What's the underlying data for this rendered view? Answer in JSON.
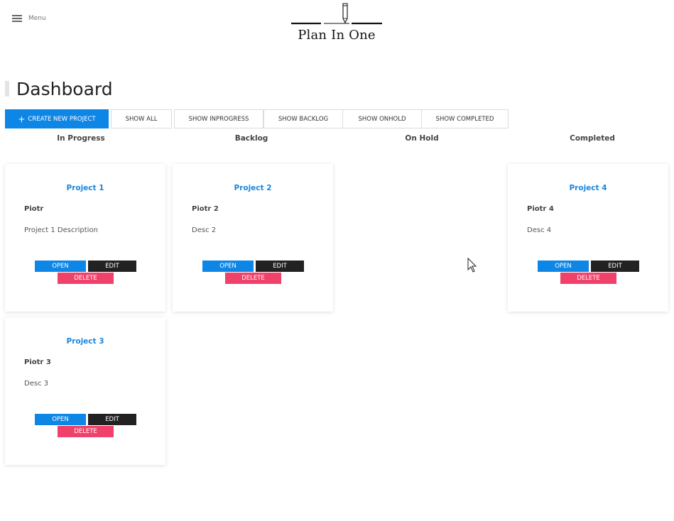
{
  "header": {
    "menu_label": "Menu",
    "logo_text": "Plan In One"
  },
  "page_title": "Dashboard",
  "filters": {
    "create": "CREATE NEW PROJECT",
    "show_all": "SHOW ALL",
    "show_inprogress": "SHOW INPROGRESS",
    "show_backlog": "SHOW BACKLOG",
    "show_onhold": "SHOW ONHOLD",
    "show_completed": "SHOW COMPLETED"
  },
  "columns": [
    "In Progress",
    "Backlog",
    "On Hold",
    "Completed"
  ],
  "card_buttons": {
    "open": "OPEN",
    "edit": "EDIT",
    "delete": "DELETE"
  },
  "projects": [
    {
      "title": "Project 1",
      "owner": "Piotr",
      "desc": "Project 1 Description",
      "status": "In Progress"
    },
    {
      "title": "Project 2",
      "owner": "Piotr 2",
      "desc": "Desc 2",
      "status": "Backlog"
    },
    {
      "title": "Project 4",
      "owner": "Piotr 4",
      "desc": "Desc 4",
      "status": "Completed"
    },
    {
      "title": "Project 3",
      "owner": "Piotr 3",
      "desc": "Desc 3",
      "status": "In Progress"
    }
  ],
  "colors": {
    "primary": "#0e86e6",
    "dark": "#222222",
    "danger": "#f0416b",
    "title_link": "#1a86dc"
  },
  "icons": [
    "hamburger-icon",
    "pencil-icon",
    "plus-icon",
    "mouse-cursor-icon"
  ]
}
